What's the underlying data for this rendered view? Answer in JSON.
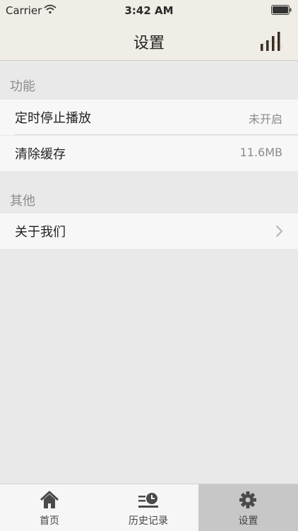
{
  "status_bar": {
    "carrier": "Carrier",
    "time": "3:42 AM"
  },
  "nav": {
    "title": "设置"
  },
  "sections": {
    "function": {
      "header": "功能",
      "timer_stop": {
        "label": "定时停止播放",
        "value": "未开启"
      },
      "clear_cache": {
        "label": "清除缓存",
        "value": "11.6MB"
      }
    },
    "other": {
      "header": "其他",
      "about": {
        "label": "关于我们"
      }
    }
  },
  "tabbar": {
    "home": "首页",
    "history": "历史记录",
    "settings": "设置",
    "active": "settings"
  },
  "colors": {
    "nav_background": "#efede5",
    "page_background": "#e9e9e9",
    "active_tab": "#c7c7c7"
  }
}
